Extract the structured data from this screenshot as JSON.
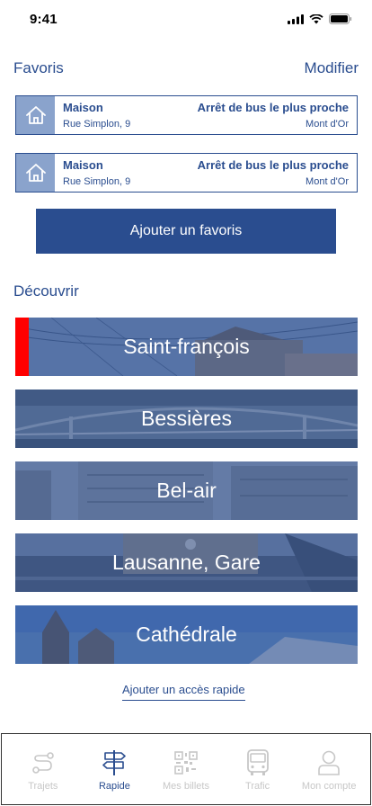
{
  "status_bar": {
    "time": "9:41"
  },
  "favorites": {
    "title": "Favoris",
    "modify_label": "Modifier",
    "items": [
      {
        "name": "Maison",
        "address": "Rue Simplon, 9",
        "type": "Arrêt de bus le plus proche",
        "stop": "Mont d'Or",
        "icon": "home-icon"
      },
      {
        "name": "Maison",
        "address": "Rue Simplon, 9",
        "type": "Arrêt de bus le plus proche",
        "stop": "Mont d'Or",
        "icon": "home-icon"
      }
    ],
    "add_label": "Ajouter un favoris"
  },
  "discover": {
    "title": "Découvrir",
    "places": [
      {
        "label": "Saint-françois",
        "highlighted": true
      },
      {
        "label": "Bessières",
        "highlighted": false
      },
      {
        "label": "Bel-air",
        "highlighted": false
      },
      {
        "label": "Lausanne, Gare",
        "highlighted": false
      },
      {
        "label": "Cathédrale",
        "highlighted": false
      }
    ],
    "add_quick_label": "Ajouter un accès rapide"
  },
  "tabs": [
    {
      "label": "Trajets",
      "icon": "route-icon",
      "active": false
    },
    {
      "label": "Rapide",
      "icon": "signpost-icon",
      "active": true
    },
    {
      "label": "Mes billets",
      "icon": "qr-code-icon",
      "active": false
    },
    {
      "label": "Trafic",
      "icon": "bus-icon",
      "active": false
    },
    {
      "label": "Mon compte",
      "icon": "user-icon",
      "active": false
    }
  ],
  "colors": {
    "primary": "#2a4d8f",
    "accent": "#ff0000",
    "icon_box": "#8aa3cc",
    "inactive": "#c7c7c7"
  }
}
